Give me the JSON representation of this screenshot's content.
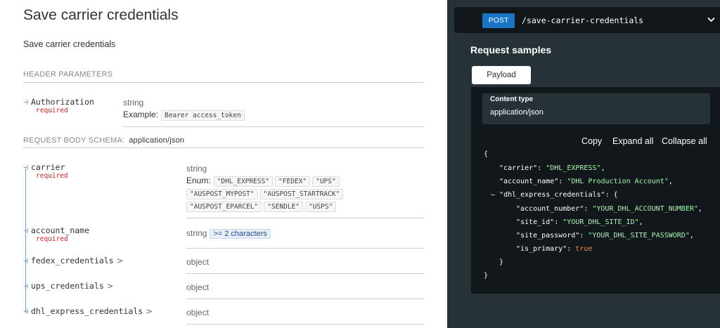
{
  "page": {
    "title": "Save carrier credentials",
    "description": "Save carrier credentials"
  },
  "header_params": {
    "heading": "HEADER PARAMETERS",
    "items": [
      {
        "name": "Authorization",
        "required": "required",
        "type": "string",
        "example_label": "Example:",
        "example_value": "Bearer access_token"
      }
    ]
  },
  "body_schema": {
    "heading": "REQUEST BODY SCHEMA:",
    "content_type": "application/json",
    "fields": [
      {
        "name": "carrier",
        "required": "required",
        "type": "string",
        "enum_label": "Enum:",
        "enum": [
          "\"DHL_EXPRESS\"",
          "\"FEDEX\"",
          "\"UPS\"",
          "\"AUSPOST_MYPOST\"",
          "\"AUSPOST_STARTRACK\"",
          "\"AUSPOST_EPARCEL\"",
          "\"SENDLE\"",
          "\"USPS\""
        ]
      },
      {
        "name": "account_name",
        "required": "required",
        "type": "string",
        "constraint": ">= 2 characters"
      },
      {
        "name": "fedex_credentials",
        "type": "object",
        "expandable": ">"
      },
      {
        "name": "ups_credentials",
        "type": "object",
        "expandable": ">"
      },
      {
        "name": "dhl_express_credentials",
        "type": "object",
        "expandable": ">"
      }
    ]
  },
  "endpoint": {
    "method": "POST",
    "path": "/save-carrier-credentials",
    "chevron_icon": "chevron-down-icon"
  },
  "samples": {
    "title": "Request samples",
    "tab": "Payload",
    "content_type_label": "Content type",
    "content_type_value": "application/json",
    "actions": {
      "copy": "Copy",
      "expand_all": "Expand all",
      "collapse_all": "Collapse all"
    },
    "json_lines": {
      "open": "{",
      "carrier_key": "\"carrier\"",
      "carrier_val": "\"DHL_EXPRESS\"",
      "account_key": "\"account_name\"",
      "account_val": "\"DHL Production Account\"",
      "collapse_toggle": "–",
      "dhl_key": "\"dhl_express_credentials\"",
      "acct_num_key": "\"account_number\"",
      "acct_num_val": "\"YOUR_DHL_ACCOUNT_NUMBER\"",
      "site_id_key": "\"site_id\"",
      "site_id_val": "\"YOUR_DHL_SITE_ID\"",
      "site_pw_key": "\"site_password\"",
      "site_pw_val": "\"YOUR_DHL_SITE_PASSWORD\"",
      "primary_key": "\"is_primary\"",
      "primary_val": "true",
      "inner_close": "}",
      "close": "}"
    }
  },
  "colors": {
    "method_bg": "#1a75c7",
    "required": "#d41f1c",
    "right_panel_bg": "#263238",
    "string_token": "#a0fbaa",
    "boolean_token": "#f08d49"
  }
}
